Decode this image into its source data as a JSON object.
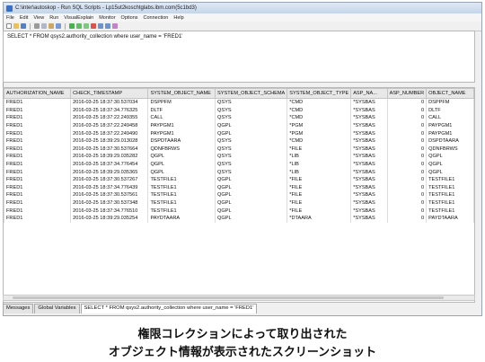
{
  "window": {
    "title": "C:\\inter\\autoskop - Run SQL Scripts - Lp15ut2koschtglabs.ibm.com(5c1bd3)"
  },
  "menu": [
    "File",
    "Edit",
    "View",
    "Run",
    "VisualExplain",
    "Monitor",
    "Options",
    "Connection",
    "Help"
  ],
  "toolbar_icons": [
    "new-icon",
    "open-icon",
    "save-icon",
    "cut-icon",
    "copy-icon",
    "paste-icon",
    "find-icon",
    "run-all-icon",
    "run-selected-icon",
    "run-from-icon",
    "stop-icon",
    "prev-icon",
    "next-icon",
    "help-icon"
  ],
  "editor": {
    "sql": "SELECT * FROM qsys2.authority_collection where user_name = 'FRED1'"
  },
  "table": {
    "columns": [
      "AUTHORIZATION_NAME",
      "CHECK_TIMESTAMP",
      "SYSTEM_OBJECT_NAME",
      "SYSTEM_OBJECT_SCHEMA",
      "SYSTEM_OBJECT_TYPE",
      "ASP_NA...",
      "ASP_NUMBER",
      "OBJECT_NAME"
    ],
    "rows": [
      [
        "FRED1",
        "2016-03-25 18:37:30.537034",
        "DSPPFM",
        "QSYS",
        "*CMD",
        "*SYSBAS",
        "0",
        "DSPPFM"
      ],
      [
        "FRED1",
        "2016-03-25 18:37:34.776325",
        "DLTF",
        "QSYS",
        "*CMD",
        "*SYSBAS",
        "0",
        "DLTF"
      ],
      [
        "FRED1",
        "2016-03-25 18:37:22.249355",
        "CALL",
        "QSYS",
        "*CMD",
        "*SYSBAS",
        "0",
        "CALL"
      ],
      [
        "FRED1",
        "2016-03-25 18:37:22.249458",
        "PAYPGM1",
        "QGPL",
        "*PGM",
        "*SYSBAS",
        "0",
        "PAYPGM1"
      ],
      [
        "FRED1",
        "2016-03-25 18:37:22.249490",
        "PAYPGM1",
        "QGPL",
        "*PGM",
        "*SYSBAS",
        "0",
        "PAYPGM1"
      ],
      [
        "FRED1",
        "2016-03-25 18:39:29.013028",
        "DSPDTAARA",
        "QSYS",
        "*CMD",
        "*SYSBAS",
        "0",
        "DSPDTAARA"
      ],
      [
        "FRED1",
        "2016-03-25 18:37:30.537664",
        "QDNFBRWS",
        "QSYS",
        "*FILE",
        "*SYSBAS",
        "0",
        "QDNFBRWS"
      ],
      [
        "FRED1",
        "2016-03-25 18:39:29.035282",
        "QGPL",
        "QSYS",
        "*LIB",
        "*SYSBAS",
        "0",
        "QGPL"
      ],
      [
        "FRED1",
        "2016-03-25 18:37:34.776454",
        "QGPL",
        "QSYS",
        "*LIB",
        "*SYSBAS",
        "0",
        "QGPL"
      ],
      [
        "FRED1",
        "2016-03-25 18:39:29.035365",
        "QGPL",
        "QSYS",
        "*LIB",
        "*SYSBAS",
        "0",
        "QGPL"
      ],
      [
        "FRED1",
        "2016-03-25 18:37:30.537267",
        "TESTFILE1",
        "QGPL",
        "*FILE",
        "*SYSBAS",
        "0",
        "TESTFILE1"
      ],
      [
        "FRED1",
        "2016-03-25 18:37:34.776439",
        "TESTFILE1",
        "QGPL",
        "*FILE",
        "*SYSBAS",
        "0",
        "TESTFILE1"
      ],
      [
        "FRED1",
        "2016-03-25 18:37:30.537561",
        "TESTFILE1",
        "QGPL",
        "*FILE",
        "*SYSBAS",
        "0",
        "TESTFILE1"
      ],
      [
        "FRED1",
        "2016-03-25 18:37:30.537348",
        "TESTFILE1",
        "QGPL",
        "*FILE",
        "*SYSBAS",
        "0",
        "TESTFILE1"
      ],
      [
        "FRED1",
        "2016-03-25 18:37:34.776510",
        "TESTFILE1",
        "QGPL",
        "*FILE",
        "*SYSBAS",
        "0",
        "TESTFILE1"
      ],
      [
        "FRED1",
        "2016-03-25 18:39:29.035254",
        "PAYDTAARA",
        "QGPL",
        "*DTAARA",
        "*SYSBAS",
        "0",
        "PAYDTAARA"
      ]
    ]
  },
  "tabs": [
    "Messages",
    "Global Variables",
    "SELECT * FROM qsys2.authority_collection where user_name = 'FRED1'"
  ],
  "caption": {
    "line1": "権限コレクションによって取り出された",
    "line2": "オブジェクト情報が表示されたスクリーンショット"
  },
  "colors": {
    "accent": "#3a6fc2",
    "header_bg": "#e8e8e8"
  }
}
